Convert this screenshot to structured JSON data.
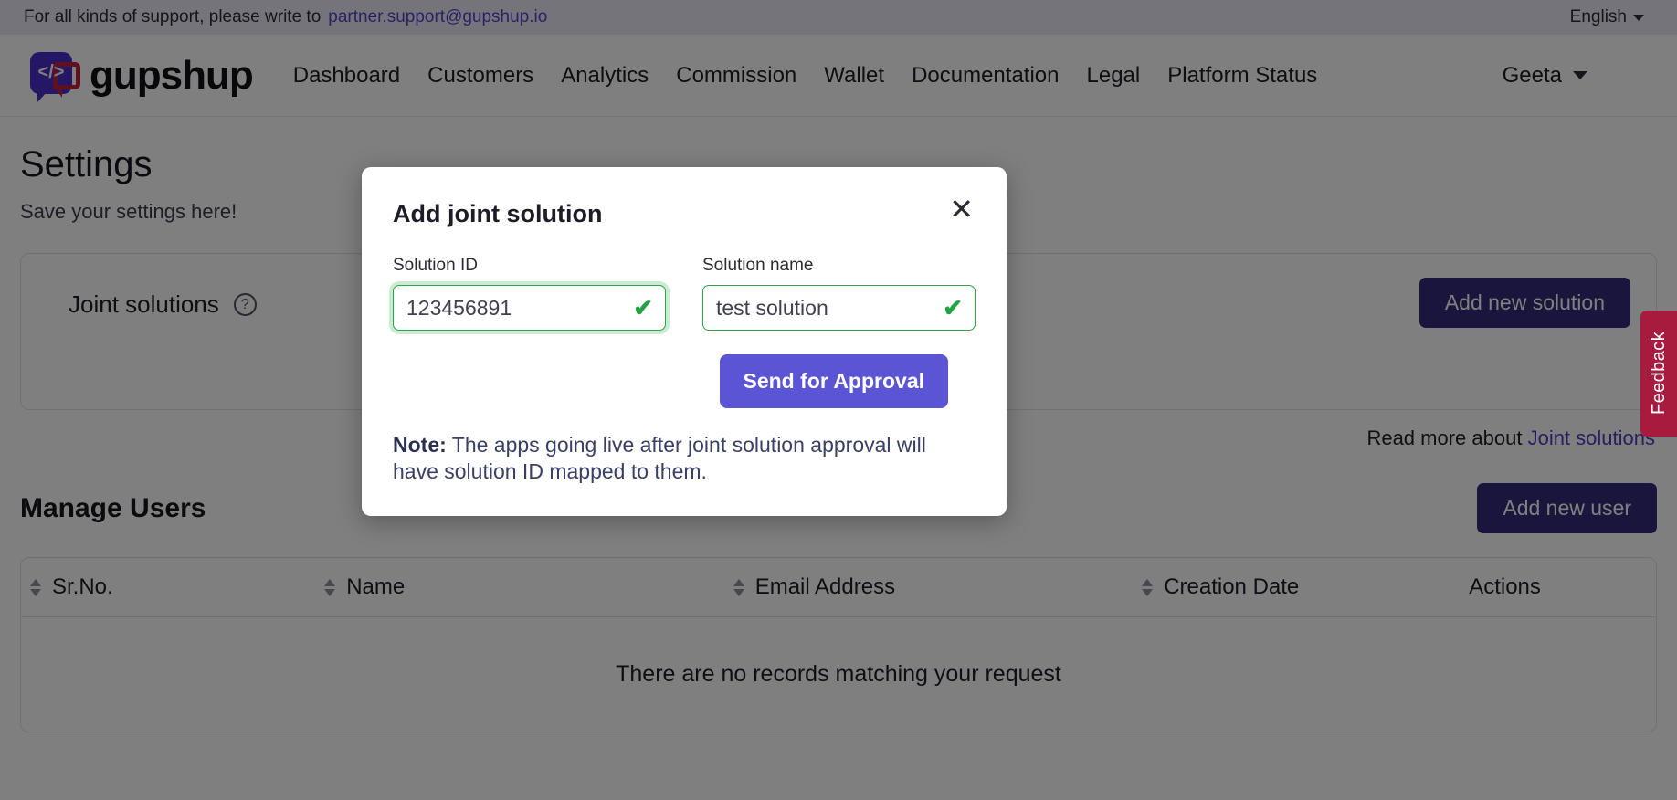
{
  "support_bar": {
    "text": "For all kinds of support, please write to",
    "email": "partner.support@gupshup.io",
    "language": "English"
  },
  "navbar": {
    "brand": "gupshup",
    "logo_glyph": "</>",
    "links": [
      "Dashboard",
      "Customers",
      "Analytics",
      "Commission",
      "Wallet",
      "Documentation",
      "Legal",
      "Platform Status"
    ],
    "user": "Geeta"
  },
  "page": {
    "title": "Settings",
    "subtitle": "Save your settings here!",
    "joint_solutions": {
      "label": "Joint solutions",
      "help_glyph": "?",
      "add_button": "Add new solution",
      "read_more_prefix": "Read more about",
      "read_more_link": "Joint solutions"
    },
    "manage_users": {
      "title": "Manage Users",
      "add_button": "Add new user",
      "columns": [
        "Sr.No.",
        "Name",
        "Email Address",
        "Creation Date",
        "Actions"
      ],
      "sortable": [
        true,
        true,
        true,
        true,
        false
      ],
      "empty_message": "There are no records matching your request"
    }
  },
  "feedback_tab": {
    "label": "Feedback",
    "color": "#a71c3e"
  },
  "modal": {
    "title": "Add joint solution",
    "close_glyph": "✕",
    "solution_id": {
      "label": "Solution ID",
      "value": "123456891",
      "placeholder": "Solution ID",
      "valid_glyph": "✔"
    },
    "solution_name": {
      "label": "Solution name",
      "value": "test solution",
      "placeholder": "Solution name",
      "valid_glyph": "✔"
    },
    "submit_label": "Send for Approval",
    "submit_color": "#5b55d6",
    "note_label": "Note:",
    "note_text": "The apps going live after joint solution approval will have solution ID mapped to them."
  }
}
